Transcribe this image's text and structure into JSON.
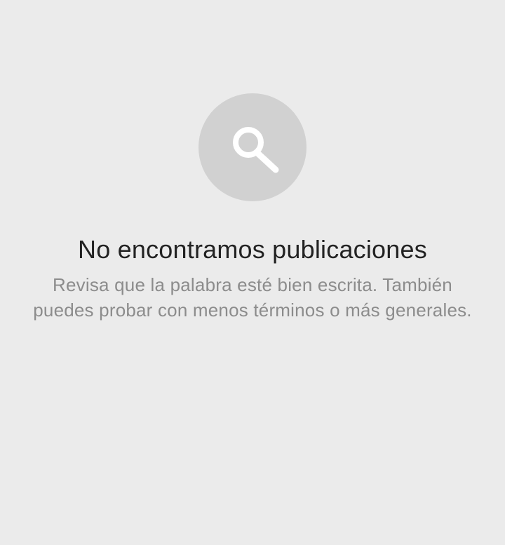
{
  "empty_state": {
    "icon": "search-icon",
    "title": "No encontramos publicaciones",
    "message": "Revisa que la palabra esté bien escrita. También puedes probar con menos términos o más generales."
  },
  "colors": {
    "background": "#ebebeb",
    "icon_circle": "#d1d1d1",
    "icon_glyph": "#ffffff",
    "title": "#222222",
    "message": "#8c8c8c"
  }
}
